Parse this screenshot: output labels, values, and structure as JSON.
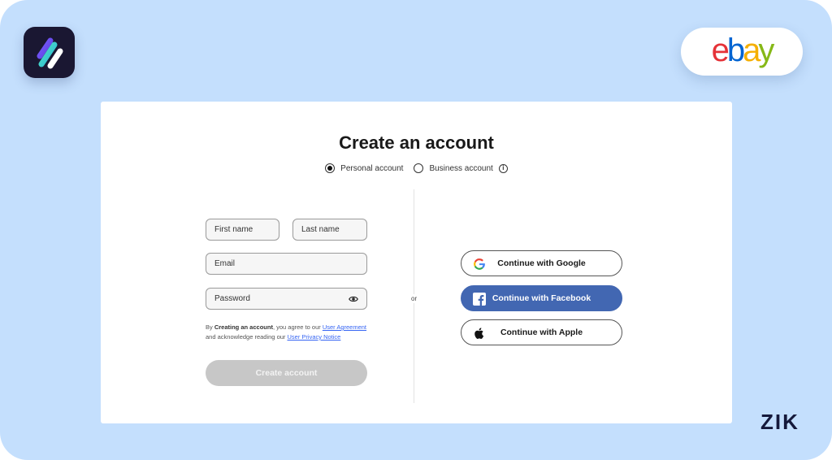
{
  "brand": {
    "name": "ebay",
    "letters": [
      {
        "char": "e",
        "color": "#e53238"
      },
      {
        "char": "b",
        "color": "#0064d2"
      },
      {
        "char": "a",
        "color": "#f5af02"
      },
      {
        "char": "y",
        "color": "#86b817"
      }
    ]
  },
  "form": {
    "title": "Create an account",
    "account_types": [
      {
        "label": "Personal account",
        "selected": true
      },
      {
        "label": "Business account",
        "selected": false
      }
    ],
    "info_glyph": "i",
    "fields": {
      "first_name_placeholder": "First name",
      "last_name_placeholder": "Last name",
      "email_placeholder": "Email",
      "password_placeholder": "Password"
    },
    "legal": {
      "prefix": "By ",
      "bold": "Creating an account",
      "middle": ", you agree to our ",
      "link1": "User Agreement",
      "middle2": " and acknowledge reading our ",
      "link2": "User Privacy Notice"
    },
    "create_label": "Create account",
    "or_label": "or"
  },
  "social": {
    "google_label": "Continue with Google",
    "facebook_label": "Continue with Facebook",
    "apple_label": "Continue with Apple"
  },
  "watermark": "ZIK",
  "colors": {
    "background": "#c4dffd",
    "facebook": "#4267b2",
    "button_disabled": "#c7c7c7",
    "link": "#3665f3"
  }
}
